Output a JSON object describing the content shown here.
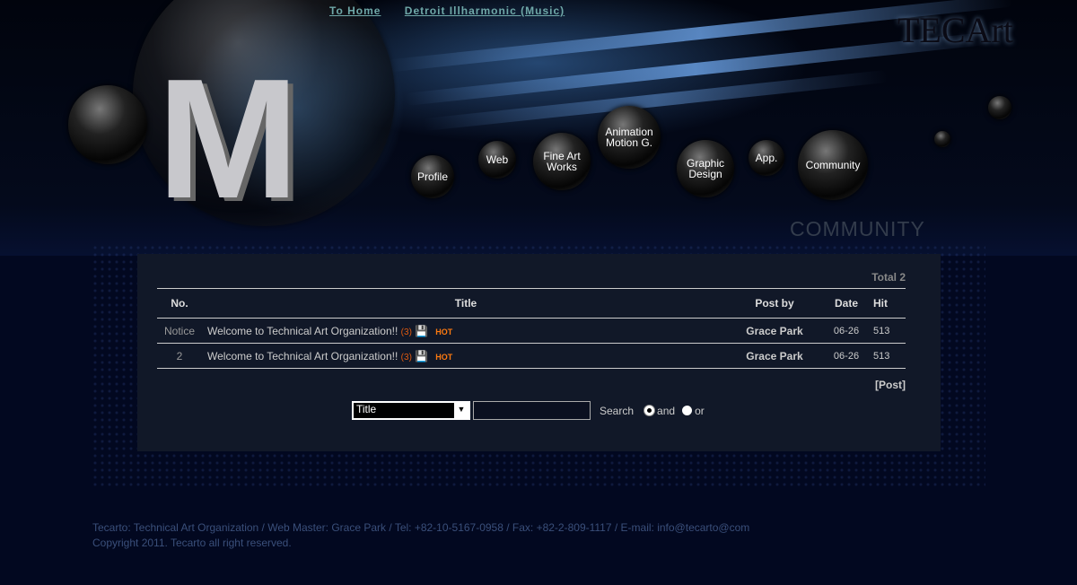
{
  "top_links": [
    "To Home",
    "Detroit Illharmonic (Music)"
  ],
  "logo": "TECArtO",
  "nav": [
    "Profile",
    "Web",
    "Fine Art Works",
    "Animation Motion G.",
    "Graphic Design",
    "App.",
    "Community"
  ],
  "section_title": "COMMUNITY",
  "board": {
    "total": "Total 2",
    "columns": [
      "No.",
      "Title",
      "Post by",
      "Date",
      "Hit"
    ],
    "rows": [
      {
        "no": "Notice",
        "title": "Welcome to Technical Art Organization!!",
        "comments": "(3)",
        "badge": "HOT",
        "author": "Grace Park",
        "date": "06-26",
        "hits": "513"
      },
      {
        "no": "2",
        "title": "Welcome to Technical Art Organization!!",
        "comments": "(3)",
        "badge": "HOT",
        "author": "Grace Park",
        "date": "06-26",
        "hits": "513"
      }
    ],
    "post_label": "[Post]"
  },
  "search": {
    "field": "Title",
    "value": "",
    "button": "Search",
    "options": [
      "and",
      "or"
    ],
    "selected": "and"
  },
  "footer": {
    "line1": "Tecarto: Technical Art Organization / Web Master: Grace Park / Tel: +82-10-5167-0958 / Fax: +82-2-809-1117 / E-mail: info@tecarto@com",
    "line2": "Copyright 2011. Tecarto all right reserved."
  }
}
